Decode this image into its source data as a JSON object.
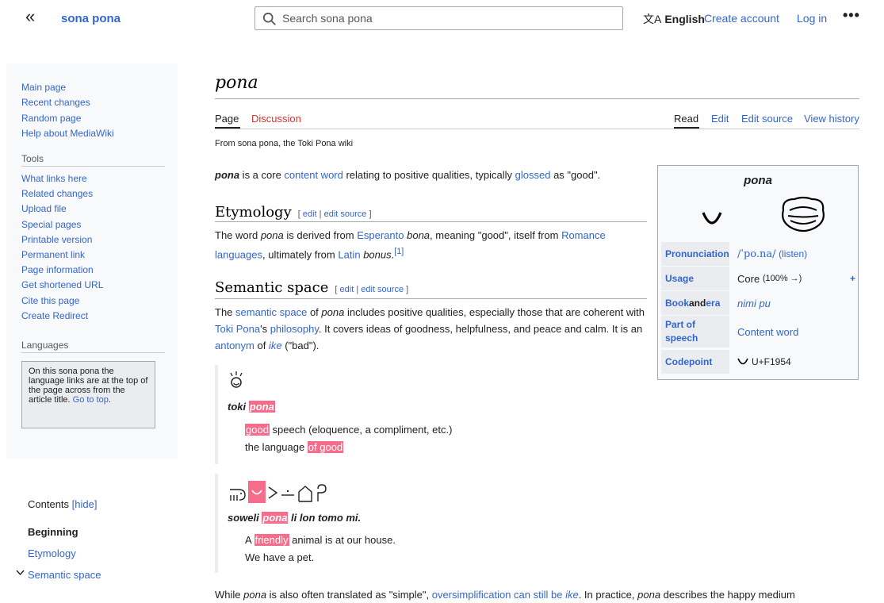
{
  "header": {
    "collapse_label": "«",
    "site_name": "sona pona",
    "search_placeholder": "Search sona pona",
    "language_icon": "translate-icon",
    "language": "English",
    "create_account": "Create account",
    "log_in": "Log in",
    "more": "•••"
  },
  "sidebar": {
    "main": [
      "Main page",
      "Recent changes",
      "Random page",
      "Help about MediaWiki"
    ],
    "tools_heading": "Tools",
    "tools": [
      "What links here",
      "Related changes",
      "Upload file",
      "Special pages",
      "Printable version",
      "Permanent link",
      "Page information",
      "Get shortened URL",
      "Cite this page",
      "Create Redirect"
    ],
    "languages_heading": "Languages",
    "lang_note": "On this sona pona the language links are at the top of the page across from the article title.",
    "lang_note_link": "Go to top"
  },
  "toc": {
    "heading": "Contents",
    "hide": "[hide]",
    "items": [
      "Beginning",
      "Etymology",
      "Semantic space"
    ]
  },
  "page": {
    "title": "pona",
    "tabs_left": [
      "Page",
      "Discussion"
    ],
    "tabs_right": [
      "Read",
      "Edit",
      "Edit source",
      "View history"
    ],
    "from": "From sona pona, the Toki Pona wiki",
    "intro": {
      "word": "pona",
      "t1": " is a core ",
      "l1": "content word",
      "t2": " relating to positive qualities, typically ",
      "l2": "glossed",
      "t3": " as \"good\"."
    },
    "etymology": {
      "heading": "Etymology",
      "edit": "edit",
      "edit_source": "edit source",
      "t1": "The word ",
      "word": "pona",
      "t2": " is derived from ",
      "l1": "Esperanto",
      "t3": " ",
      "bona": "bona",
      "t4": ", meaning \"good\", itself from ",
      "l2": "Romance languages",
      "t5": ", ultimately from ",
      "l3": "Latin",
      "t6": " ",
      "bonus": "bonus",
      "t7": ".",
      "ref": "[1]"
    },
    "semantic": {
      "heading": "Semantic space",
      "edit": "edit",
      "edit_source": "edit source",
      "t1": "The ",
      "l1": "semantic space",
      "t2": " of ",
      "word": "pona",
      "t3": " includes positive qualities, especially those that are coherent with ",
      "l2": "Toki Pona",
      "t4": "'s ",
      "l3": "philosophy",
      "t5": ". It covers ideas of goodness, helpfulness, and peace and calm. It is an ",
      "l4": "antonym",
      "t6": " of ",
      "l5": "ike",
      "t7": " (\"bad\")."
    },
    "example1": {
      "glyph": "ᵕ̈",
      "phrase_a": "toki",
      "phrase_hl": "pona",
      "line1_hl": "good",
      "line1": " speech (eloquence, a compliment, etc.)",
      "line2": "the language ",
      "line2_hl": "of good"
    },
    "example2": {
      "phrase_a": "soweli",
      "phrase_hl": "pona",
      "phrase_b": " li lon tomo mi.",
      "line1_a": "A ",
      "line1_hl": "friendly",
      "line1_b": " animal is at our house.",
      "line2": "We have a pet."
    },
    "bottom": {
      "t1": "While ",
      "w1": "pona",
      "t2": " is also often translated as \"simple\", ",
      "l1": "oversimplification can still be ",
      "l1i": "ike",
      "t3": ". In practice, ",
      "w2": "pona",
      "t4": " describes the happy medium"
    }
  },
  "infobox": {
    "title": "pona",
    "rows": [
      {
        "label": "Pronunciation",
        "value": "/ˈpo.na/",
        "extra": "(listen)"
      },
      {
        "label": "Usage",
        "value": "Core",
        "extra": "(100% →)",
        "plus": "+"
      },
      {
        "label_a": "Book",
        "label_b": " and ",
        "label_c": "era",
        "value": "nimi pu"
      },
      {
        "label": "Part of speech",
        "value": "Content word"
      },
      {
        "label": "Codepoint",
        "value": "U+F1954"
      }
    ]
  }
}
